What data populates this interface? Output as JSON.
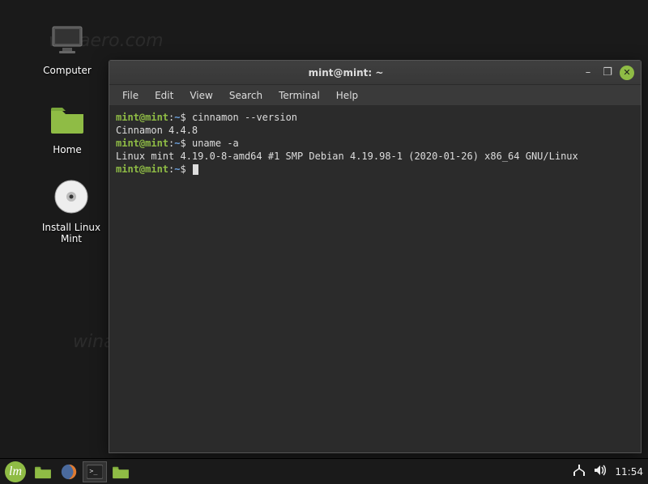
{
  "desktop_icons": {
    "computer": "Computer",
    "home": "Home",
    "install": "Install Linux Mint"
  },
  "window": {
    "title": "mint@mint: ~",
    "menus": [
      "File",
      "Edit",
      "View",
      "Search",
      "Terminal",
      "Help"
    ],
    "terminal": {
      "prompt_user": "mint@mint",
      "prompt_sep": ":",
      "prompt_path": "~",
      "prompt_sym": "$",
      "lines": [
        {
          "cmd": "cinnamon --version"
        },
        {
          "out": "Cinnamon 4.4.8"
        },
        {
          "cmd": "uname -a"
        },
        {
          "out": "Linux mint 4.19.0-8-amd64 #1 SMP Debian 4.19.98-1 (2020-01-26) x86_64 GNU/Linux"
        },
        {
          "cmd": "",
          "cursor": true
        }
      ]
    }
  },
  "panel": {
    "clock": "11:54"
  },
  "watermark": "winaero.com"
}
